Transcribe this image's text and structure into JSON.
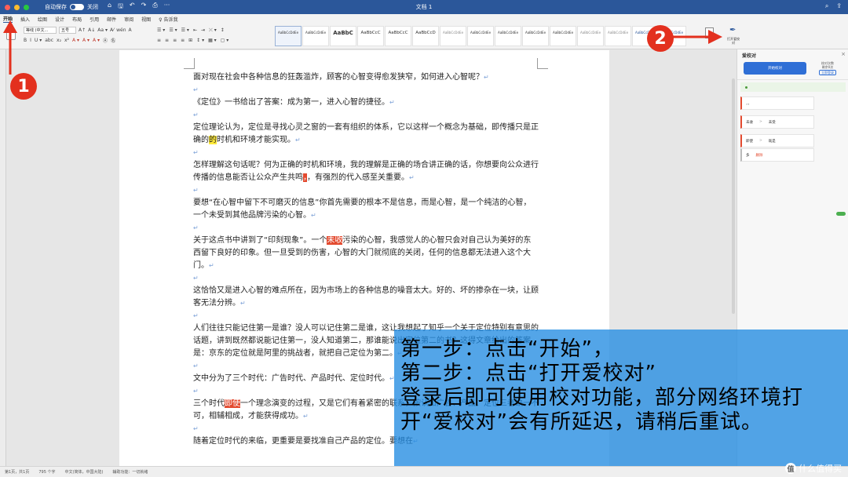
{
  "window": {
    "title": "文档 1",
    "autosave_label": "自动保存",
    "autosave_state": "关闭",
    "traffic_lights": [
      "#ff5f57",
      "#febc2e",
      "#28c840"
    ],
    "quick_access": [
      "⌂",
      "🖫",
      "↶",
      "↷",
      "⎙",
      "···"
    ],
    "right_icons": [
      "⌕",
      "⇪"
    ]
  },
  "menu": {
    "tabs": [
      "开始",
      "插入",
      "绘图",
      "设计",
      "布局",
      "引用",
      "邮件",
      "审阅",
      "视图",
      "♀ 告诉我"
    ],
    "active_index": 0
  },
  "ribbon": {
    "paste_label": "粘贴",
    "font_name": "等线 (中文...",
    "font_size": "五号",
    "font_row1": [
      "A↑",
      "A↓",
      "Aa ▾",
      "A⁄",
      "wén",
      "A"
    ],
    "font_row2": [
      "B",
      "I",
      "U ▾",
      "abc",
      "x₂",
      "x²",
      "A ▾",
      "A ▾",
      "A ▾",
      "Ⓐ",
      "㊔"
    ],
    "para_row1": [
      "☰ ▾",
      "☰ ▾",
      "☰ ▾",
      "⇤",
      "⇥",
      "⤫ ▾",
      "↕"
    ],
    "para_row2": [
      "≡",
      "≡",
      "≡",
      "≡",
      "⊞",
      "↕ ▾",
      "▦ ▾",
      "▢ ▾"
    ],
    "styles": [
      {
        "preview": "AaBbCcDdEe",
        "name": "",
        "kind": "sel"
      },
      {
        "preview": "AaBbCcDdEe",
        "name": "",
        "kind": ""
      },
      {
        "preview": "AaBbC",
        "name": "",
        "kind": "big"
      },
      {
        "preview": "AaBbCcC",
        "name": "",
        "kind": "mid"
      },
      {
        "preview": "AaBbCcC",
        "name": "",
        "kind": "mid"
      },
      {
        "preview": "AaBbCcD",
        "name": "",
        "kind": "mid"
      },
      {
        "preview": "AaBbCcDdEe",
        "name": "",
        "kind": "gray"
      },
      {
        "preview": "AaBbCcDdEe",
        "name": "",
        "kind": ""
      },
      {
        "preview": "AaBbCcDdEe",
        "name": "",
        "kind": ""
      },
      {
        "preview": "AaBbCcDdEe",
        "name": "",
        "kind": ""
      },
      {
        "preview": "AaBbCcDdEe",
        "name": "",
        "kind": ""
      },
      {
        "preview": "AaBbCcDdEe",
        "name": "",
        "kind": "gray"
      },
      {
        "preview": "AaBbCcDdEe",
        "name": "",
        "kind": "gray"
      },
      {
        "preview": "AaBbCcDdEe",
        "name": "",
        "kind": "blue"
      },
      {
        "preview": "AaBbCcDdEe",
        "name": "",
        "kind": "blue"
      }
    ],
    "styles_pane_label": "",
    "aijiaodui_button": "打开爱校对"
  },
  "document": {
    "paragraphs": [
      [
        {
          "t": "面对现在社会中各种信息的狂轰滥炸，顾客的心智变得愈发狭窄，如何进入心智呢？"
        }
      ],
      [],
      [
        {
          "t": "《定位》一书给出了答案：成为第一，进入心智的捷径。"
        }
      ],
      [],
      [
        {
          "t": "定位理论认为，定位是寻找心灵之窗的一套有组织的体系，它以这样一个概念为基础，即传播只是正确的"
        },
        {
          "t": "的",
          "hl": "yellow"
        },
        {
          "t": "时机和环境才能实现。"
        }
      ],
      [],
      [
        {
          "t": "怎样理解这句话呢？何为正确的时机和环境，我的理解是正确的场合讲正确的话，你想要向公众进行传播的信息能否让公众产生共鸣"
        },
        {
          "t": "，",
          "hl": "red"
        },
        {
          "t": "，有强烈的代入感至关重要。"
        }
      ],
      [],
      [
        {
          "t": "要想“在心智中留下不可磨灭的信息”你首先需要的根本不是信息，而是心智，是一个纯洁的心智，一个未受到其他品牌污染的心智。"
        }
      ],
      [],
      [
        {
          "t": "关于这点书中讲到了“印刻现象”。一个"
        },
        {
          "t": "未收",
          "hl": "red"
        },
        {
          "t": "污染的心智，我感觉人的心智只会对自己认为美好的东西留下良好的印象。但一旦受到的伤害，心智的大门就彻底的关闭，任何的信息都无法进入这个大门。"
        }
      ],
      [],
      [
        {
          "t": "这恰恰又是进入心智的难点所在，因为市场上的各种信息的噪音太大。好的、坏的掺杂在一块，让顾客无法分辨。"
        }
      ],
      [],
      [
        {
          "t": "人们往往只能记住第一是谁？没人可以记住第二是谁，这让我想起了知乎一个关于定位特别有意思的话题，讲到既然都说能记住第一，没人知道第二，那谁能说出定位第二的书？这得文章给出的答案是：京东的定位就是阿里的挑战者，就把自己定位为第二。"
        }
      ],
      [],
      [
        {
          "t": "文中分为了三个时代：广告时代、产品时代、定位时代。"
        }
      ],
      [],
      [
        {
          "t": "三个时代"
        },
        {
          "t": "即使",
          "hl": "red"
        },
        {
          "t": "一个理念演变的过程，又是它们有着紧密的联系，按认知广告、产品、定位三者缺一不可，相辅相成，才能获得成功。"
        }
      ],
      [],
      [
        {
          "t": "随着定位时代的来临，更重要是要找准自己产品的定位。要想在"
        }
      ]
    ]
  },
  "panel": {
    "title": "爱校对",
    "close": "×",
    "start_button": "开始校对",
    "info_lines": [
      "校对次数",
      "剩余0次"
    ],
    "login": "立即登录",
    "ok_text": "",
    "suggestions": [
      {
        "from": "，，",
        "arrow": "",
        "to": "",
        "extra": "",
        "dim": false
      },
      {
        "from": "未收",
        "arrow": ">",
        "to": "未受",
        "extra": "",
        "dim": false
      },
      {
        "from": "即使",
        "arrow": ">",
        "to": "既是",
        "extra": "",
        "dim": false
      },
      {
        "from": "多",
        "arrow": "",
        "to": "",
        "extra": "删除",
        "dim": true
      }
    ],
    "settings": [
      {
        "label": "",
        "value": "",
        "toggle": true
      },
      {
        "label": "",
        "value": "",
        "toggle": false
      },
      {
        "label": "",
        "value": "",
        "toggle": false
      },
      {
        "label": "",
        "value": "",
        "toggle": false
      },
      {
        "label": "",
        "value": "",
        "toggle": false
      }
    ]
  },
  "statusbar": {
    "items": [
      "第1页，共1页",
      "795 个字",
      "中文(简体，中国大陆)",
      "辅助功能：一切就绪"
    ]
  },
  "overlay": {
    "lines": [
      "第一步：点击“开始”，",
      "第二步：点击“打开爱校对”",
      "登录后即可使用校对功能，部分网络环境打开“爱校对”会有所延迟，请稍后重试。"
    ],
    "badge_1": "1",
    "badge_2": "2",
    "watermark": "什么值得买",
    "watermark_icon": "值",
    "overlay_color": "#238ce1",
    "arrow_color": "#e3301e"
  }
}
